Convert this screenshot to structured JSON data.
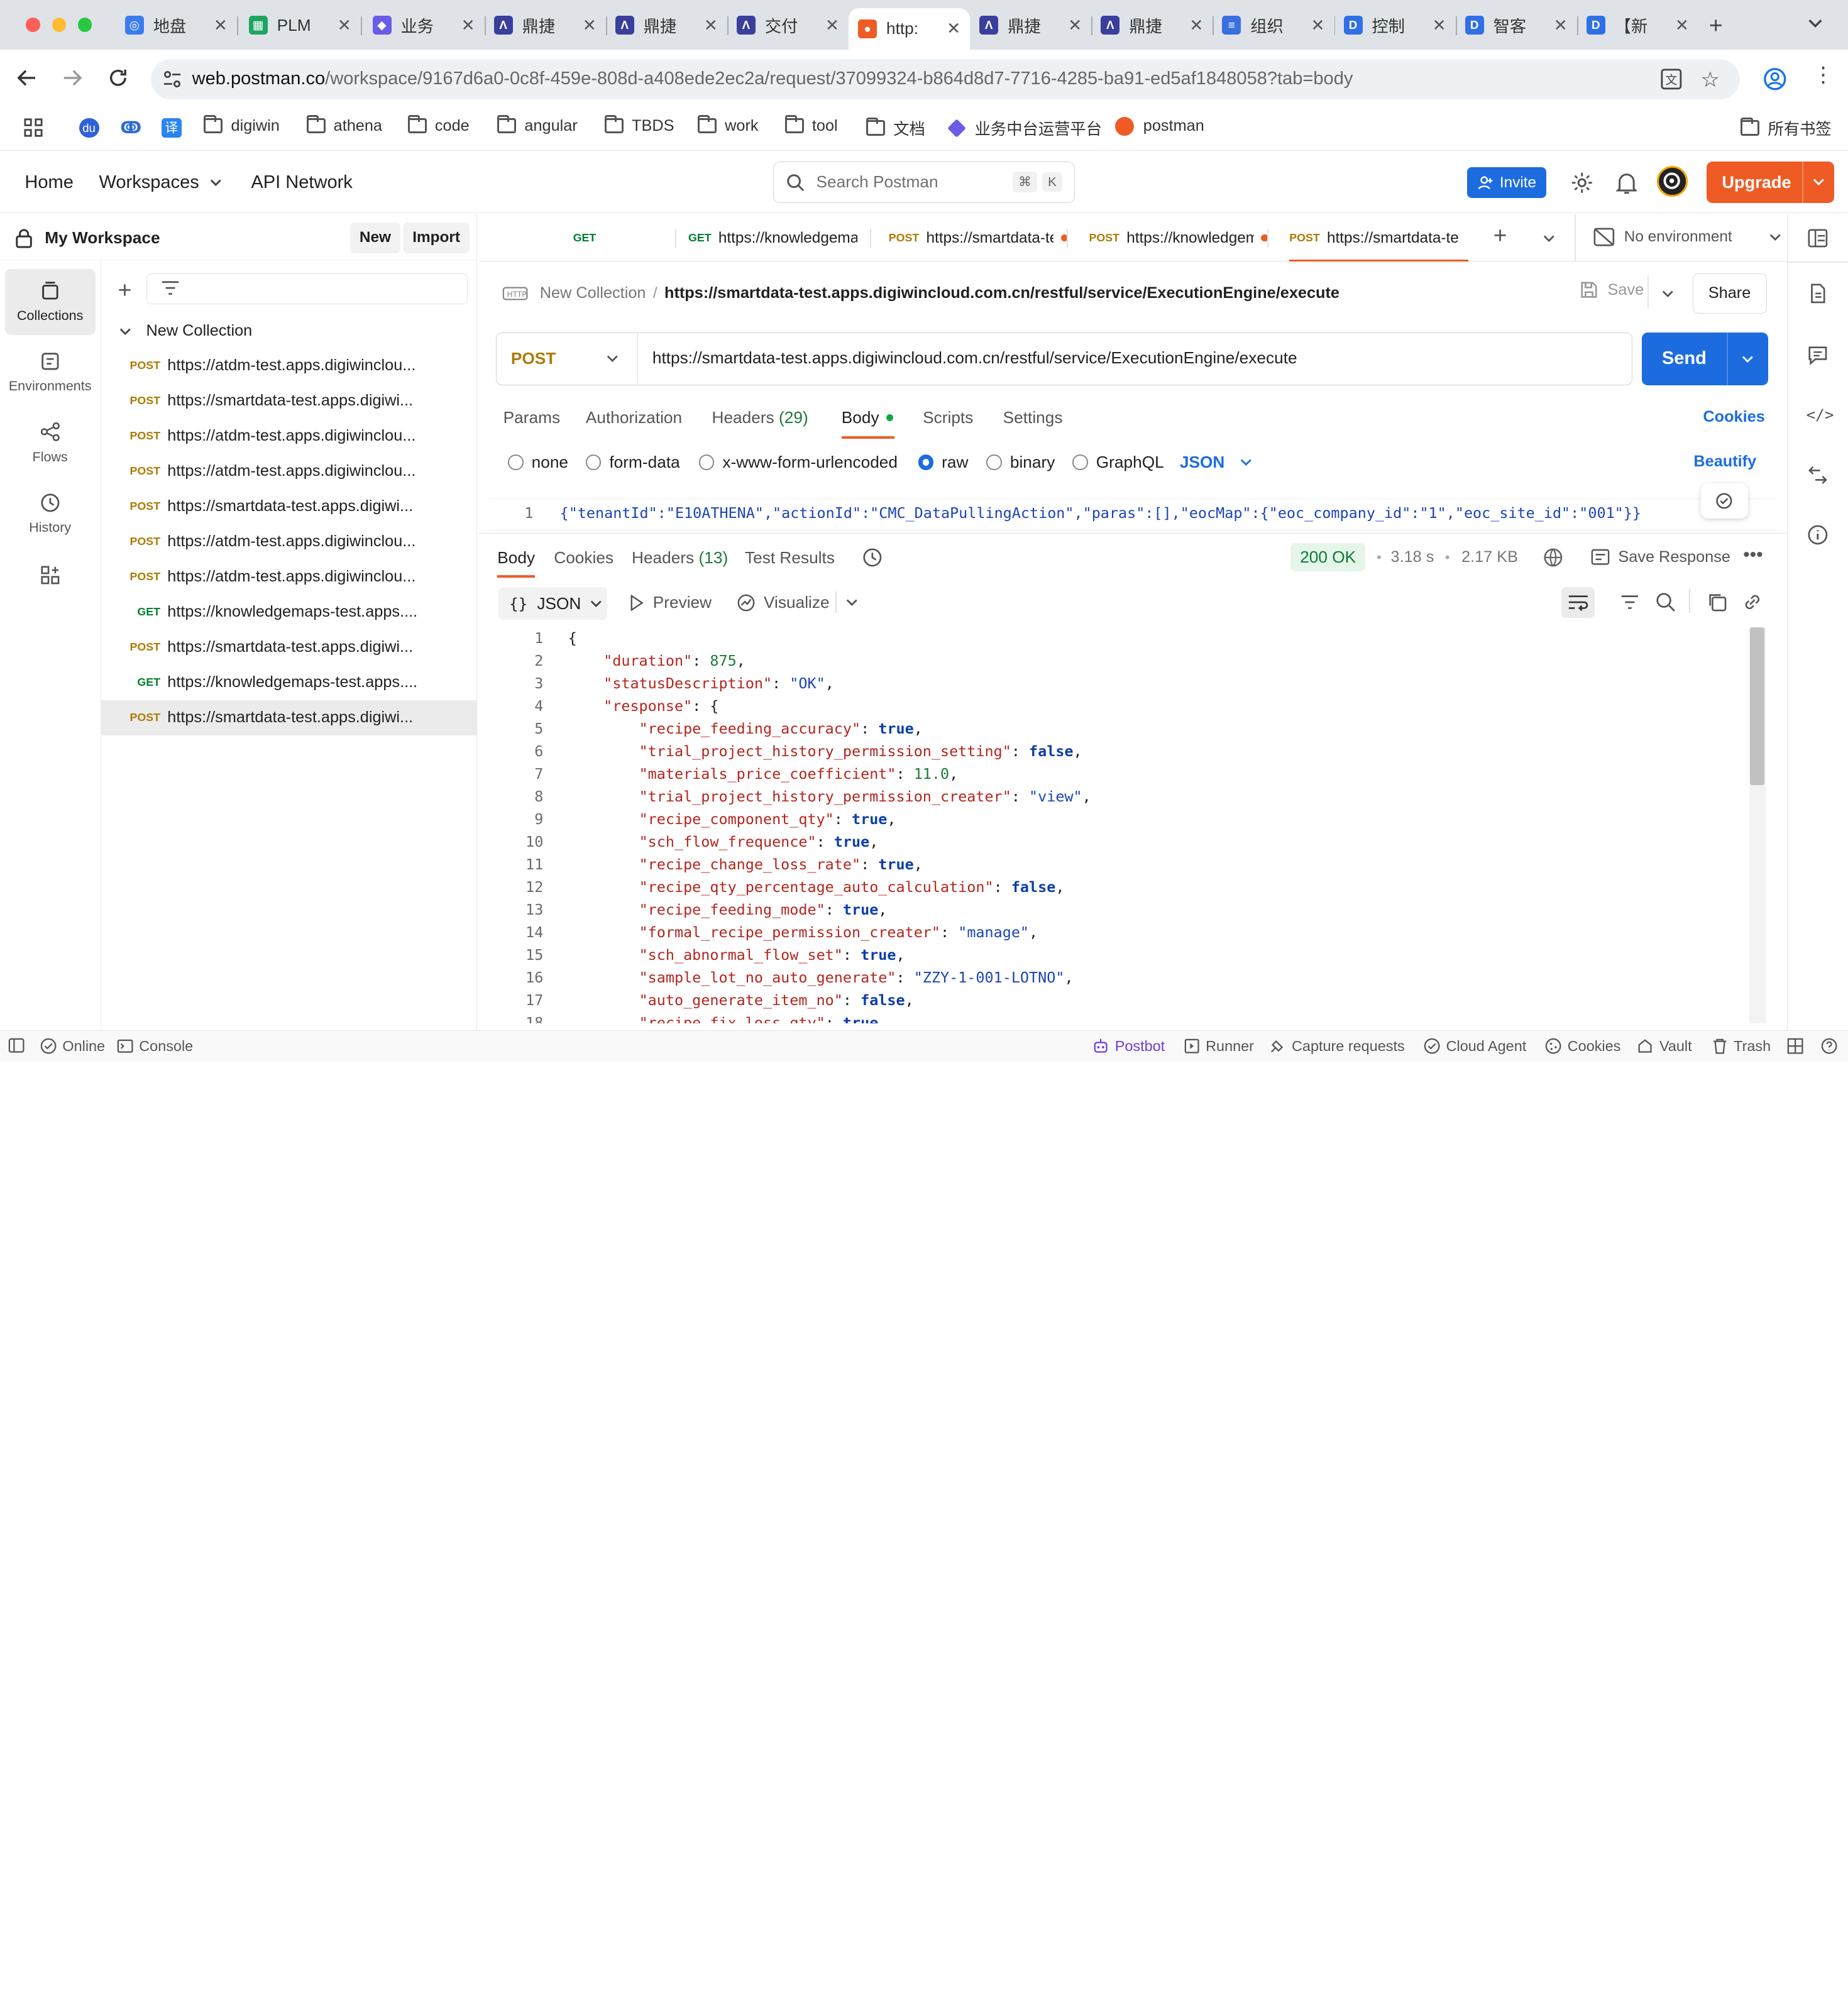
{
  "browser": {
    "tabs": [
      {
        "title": "地盘",
        "icon": "globe-icon",
        "color": "#3b7bf0"
      },
      {
        "title": "PLM",
        "icon": "sheet-icon",
        "color": "#1fa463"
      },
      {
        "title": "业务",
        "icon": "cube-icon",
        "color": "#6b5ce7"
      },
      {
        "title": "鼎捷",
        "icon": "a-logo-icon",
        "color": "#3a3f9e"
      },
      {
        "title": "鼎捷",
        "icon": "a-logo-icon",
        "color": "#3a3f9e"
      },
      {
        "title": "交付",
        "icon": "a-logo-icon",
        "color": "#3a3f9e"
      },
      {
        "title": "http:",
        "icon": "postman-icon",
        "color": "#ef5b25"
      },
      {
        "title": "鼎捷",
        "icon": "a-logo-icon",
        "color": "#3a3f9e"
      },
      {
        "title": "鼎捷",
        "icon": "a-logo-icon",
        "color": "#3a3f9e"
      },
      {
        "title": "组织",
        "icon": "doc-icon",
        "color": "#3b6fe0"
      },
      {
        "title": "控制",
        "icon": "d-logo-icon",
        "color": "#2f6fe8"
      },
      {
        "title": "智客",
        "icon": "d-logo-icon",
        "color": "#2f6fe8"
      },
      {
        "title": "【新",
        "icon": "d-logo-icon",
        "color": "#2f6fe8"
      }
    ],
    "url_domain": "web.postman.co",
    "url_path": "/workspace/9167d6a0-0c8f-459e-808d-a408ede2ec2a/request/37099324-b864d8d7-7716-4285-ba91-ed5af1848058?tab=body",
    "bookmarks": [
      "digiwin",
      "athena",
      "code",
      "angular",
      "TBDS",
      "work",
      "tool",
      "文档",
      "业务中台运营平台",
      "postman"
    ],
    "all_bookmarks": "所有书签"
  },
  "header": {
    "home": "Home",
    "workspaces": "Workspaces",
    "api_network": "API Network",
    "search_placeholder": "Search Postman",
    "kbd1": "⌘",
    "kbd2": "K",
    "invite": "Invite",
    "upgrade": "Upgrade"
  },
  "sidebar": {
    "workspace": "My Workspace",
    "new": "New",
    "import": "Import",
    "rail": [
      "Collections",
      "Environments",
      "Flows",
      "History"
    ],
    "collection": "New Collection",
    "requests": [
      {
        "method": "POST",
        "url": "https://atdm-test.apps.digiwinclou..."
      },
      {
        "method": "POST",
        "url": "https://smartdata-test.apps.digiwi..."
      },
      {
        "method": "POST",
        "url": "https://atdm-test.apps.digiwinclou..."
      },
      {
        "method": "POST",
        "url": "https://atdm-test.apps.digiwinclou..."
      },
      {
        "method": "POST",
        "url": "https://smartdata-test.apps.digiwi..."
      },
      {
        "method": "POST",
        "url": "https://atdm-test.apps.digiwinclou..."
      },
      {
        "method": "POST",
        "url": "https://atdm-test.apps.digiwinclou..."
      },
      {
        "method": "GET",
        "url": "https://knowledgemaps-test.apps...."
      },
      {
        "method": "POST",
        "url": "https://smartdata-test.apps.digiwi..."
      },
      {
        "method": "GET",
        "url": "https://knowledgemaps-test.apps...."
      },
      {
        "method": "POST",
        "url": "https://smartdata-test.apps.digiwi..."
      }
    ]
  },
  "request_tabs": [
    {
      "method": "GET",
      "url": ""
    },
    {
      "method": "GET",
      "url": "https://knowledgemap"
    },
    {
      "method": "POST",
      "url": "https://smartdata-te"
    },
    {
      "method": "POST",
      "url": "https://knowledgem"
    },
    {
      "method": "POST",
      "url": "https://smartdata-te"
    }
  ],
  "environment": "No environment",
  "request": {
    "collection": "New Collection",
    "separator": "/",
    "title": "https://smartdata-test.apps.digiwincloud.com.cn/restful/service/ExecutionEngine/execute",
    "save": "Save",
    "share": "Share",
    "method": "POST",
    "url": "https://smartdata-test.apps.digiwincloud.com.cn/restful/service/ExecutionEngine/execute",
    "send": "Send",
    "tabs": {
      "params": "Params",
      "authorization": "Authorization",
      "headers": "Headers",
      "headers_count": "(29)",
      "body": "Body",
      "scripts": "Scripts",
      "settings": "Settings",
      "cookies": "Cookies"
    },
    "body_types": [
      "none",
      "form-data",
      "x-www-form-urlencoded",
      "raw",
      "binary",
      "GraphQL"
    ],
    "selected_body_type": "raw",
    "raw_format": "JSON",
    "beautify": "Beautify",
    "body_line": "1",
    "body": "{\"tenantId\":\"E10ATHENA\",\"actionId\":\"CMC_DataPullingAction\",\"paras\":[],\"eocMap\":{\"eoc_company_id\":\"1\",\"eoc_site_id\":\"001\"}}"
  },
  "response": {
    "tabs": {
      "body": "Body",
      "cookies": "Cookies",
      "headers": "Headers",
      "headers_count": "(13)",
      "test_results": "Test Results"
    },
    "status": "200 OK",
    "time": "3.18 s",
    "size": "2.17 KB",
    "save_response": "Save Response",
    "format": "JSON",
    "preview": "Preview",
    "visualize": "Visualize",
    "lines": [
      "{",
      "    \"duration\": 875,",
      "    \"statusDescription\": \"OK\",",
      "    \"response\": {",
      "        \"recipe_feeding_accuracy\": true,",
      "        \"trial_project_history_permission_setting\": false,",
      "        \"materials_price_coefficient\": 11.0,",
      "        \"trial_project_history_permission_creater\": \"view\",",
      "        \"recipe_component_qty\": true,",
      "        \"sch_flow_frequence\": true,",
      "        \"recipe_change_loss_rate\": true,",
      "        \"recipe_qty_percentage_auto_calculation\": false,",
      "        \"recipe_feeding_mode\": true,",
      "        \"formal_recipe_permission_creater\": \"manage\",",
      "        \"sch_abnormal_flow_set\": true,",
      "        \"sample_lot_no_auto_generate\": \"ZZY-1-001-LOTNO\",",
      "        \"auto_generate_item_no\": false,",
      "        \"recipe_fix_loss_qty\": true,"
    ]
  },
  "statusbar": {
    "online": "Online",
    "console": "Console",
    "postbot": "Postbot",
    "runner": "Runner",
    "capture": "Capture requests",
    "cloud_agent": "Cloud Agent",
    "cookies": "Cookies",
    "vault": "Vault",
    "trash": "Trash"
  }
}
